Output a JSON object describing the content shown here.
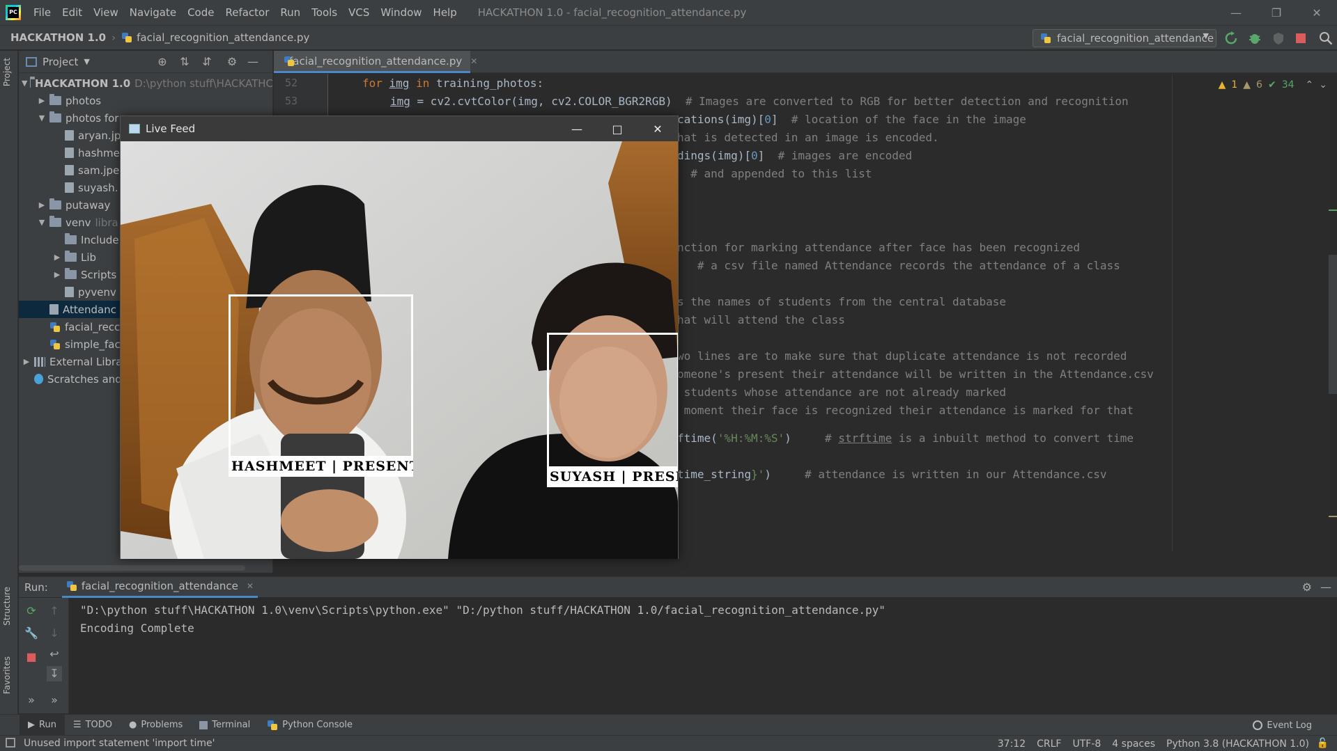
{
  "app": {
    "window_title": "HACKATHON 1.0 - facial_recognition_attendance.py",
    "menu": [
      "File",
      "Edit",
      "View",
      "Navigate",
      "Code",
      "Refactor",
      "Run",
      "Tools",
      "VCS",
      "Window",
      "Help"
    ]
  },
  "navbar": {
    "project": "HACKATHON 1.0",
    "file": "facial_recognition_attendance.py",
    "run_config": "facial_recognition_attendance"
  },
  "sidebar_strip": {
    "project_label": "Project",
    "structure_label": "Structure",
    "favorites_label": "Favorites"
  },
  "project_panel": {
    "title": "Project",
    "tree": [
      {
        "label": "HACKATHON 1.0",
        "extra": "D:\\python stuff\\HACKATHC"
      },
      {
        "label": "photos"
      },
      {
        "label": "photos for"
      },
      {
        "label": "aryan.jp"
      },
      {
        "label": "hashme"
      },
      {
        "label": "sam.jpe"
      },
      {
        "label": "suyash."
      },
      {
        "label": "putaway"
      },
      {
        "label": "venv",
        "extra": "libra"
      },
      {
        "label": "Include"
      },
      {
        "label": "Lib"
      },
      {
        "label": "Scripts"
      },
      {
        "label": "pyvenv"
      },
      {
        "label": "Attendanc"
      },
      {
        "label": "facial_recc"
      },
      {
        "label": "simple_fac"
      },
      {
        "label": "External Libra"
      },
      {
        "label": "Scratches and"
      }
    ]
  },
  "editor": {
    "tab": "facial_recognition_attendance.py",
    "line_numbers": [
      "52",
      "53"
    ],
    "inspections": {
      "warnings": "1",
      "weak_warnings": "6",
      "ok": "34"
    },
    "lines": {
      "l1_kw1": "for ",
      "l1_var": "img",
      "l1_kw2": " in ",
      "l1_rest": "training_photos:",
      "l2_var": "img",
      "l2_code": " = cv2.cvtColor(img, cv2.COLOR_BGR2RGB)",
      "l2_comment": "  # Images are converted to RGB for better detection and recognition",
      "l3_code": "cations(img)[",
      "l3_num": "0",
      "l3_code2": "]",
      "l3_comment": "  # location of the face in the image",
      "l4_comment": "hat is detected in an image is encoded.",
      "l5_code": "dings(img)[",
      "l5_num": "0",
      "l5_code2": "]",
      "l5_comment": "  # images are encoded",
      "l6_comment": "  # and appended to this list",
      "l7_comment": "nction for marking attendance after face has been recognized",
      "l8_comment": "   # a csv file named Attendance records the attendance of a class",
      "l9_comment": "s the names of students from the central database",
      "l10_comment": "hat will attend the class",
      "l11_comment": "wo lines are to make sure that duplicate attendance is not recorded",
      "l12_comment": "omeone's present their attendance will be written in the Attendance.csv",
      "l13_comment": " students whose attendance are not already marked",
      "l14_comment": " moment their face is recognized their attendance is marked for that",
      "l15_code": "ftime(",
      "l15_str": "'%H:%M:%S'",
      "l15_code2": ")",
      "l15_comment1": "     # ",
      "l15_comment_ul": "strftime",
      "l15_comment2": " is a inbuilt method to convert time",
      "l16_code": "time_string",
      "l16_str": "}'",
      "l16_code2": ")",
      "l16_comment": "     # attendance is written in our Attendance.csv"
    }
  },
  "live_feed": {
    "title": "Live Feed",
    "faces": [
      {
        "label": "HASHMEET | PRESENT"
      },
      {
        "label": "SUYASH | PRESE"
      }
    ]
  },
  "run_panel": {
    "label": "Run:",
    "tab": "facial_recognition_attendance",
    "console": [
      "\"D:\\python stuff\\HACKATHON 1.0\\venv\\Scripts\\python.exe\" \"D:/python stuff/HACKATHON 1.0/facial_recognition_attendance.py\"",
      "Encoding Complete"
    ]
  },
  "tool_tabs": [
    "Run",
    "TODO",
    "Problems",
    "Terminal",
    "Python Console"
  ],
  "event_log": "Event Log",
  "status": {
    "message": "Unused import statement 'import time'",
    "position": "37:12",
    "line_sep": "CRLF",
    "encoding": "UTF-8",
    "indent": "4 spaces",
    "interpreter": "Python 3.8 (HACKATHON 1.0)"
  }
}
